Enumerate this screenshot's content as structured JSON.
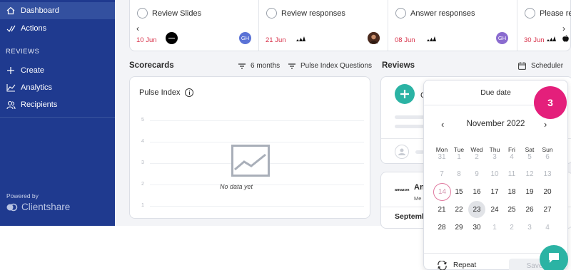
{
  "sidebar": {
    "items": [
      {
        "label": "Dashboard",
        "icon": "home-icon",
        "active": true
      },
      {
        "label": "Actions",
        "icon": "actions-check-icon"
      }
    ],
    "section_title": "REVIEWS",
    "review_items": [
      {
        "label": "Create",
        "icon": "plus-icon"
      },
      {
        "label": "Analytics",
        "icon": "analytics-chart-icon"
      },
      {
        "label": "Recipients",
        "icon": "recipients-icon"
      }
    ],
    "powered_by": "Powered by",
    "brand": "Clientshare",
    "colors": {
      "background": "#1f3a8f",
      "active": "#33509f"
    }
  },
  "tasks": [
    {
      "title": "Review Slides",
      "date": "10 Jun",
      "org_logo": "black-circle-logo",
      "avatar": "GH",
      "avatar_color": "#5a72d6"
    },
    {
      "title": "Review responses",
      "date": "21 Jun",
      "org_logo": "adidas-logo",
      "avatar": "photo-avatar"
    },
    {
      "title": "Answer responses",
      "date": "08 Jun",
      "org_logo": "adidas-logo",
      "avatar": "GH",
      "avatar_color": "#8a6bcf"
    },
    {
      "title": "Please rev",
      "date": "30 Jun",
      "org_logo": "adidas-logo",
      "avatar": "apple-logo"
    }
  ],
  "scorecards": {
    "title": "Scorecards",
    "filter_period": "6 months",
    "filter_questions": "Pulse Index Questions"
  },
  "pulse": {
    "title": "Pulse Index",
    "info": "i",
    "y_ticks": [
      "5",
      "4",
      "3",
      "2",
      "1"
    ],
    "empty_text": "No data yet"
  },
  "reviews": {
    "title": "Reviews",
    "scheduler_label": "Scheduler",
    "card_letter": "C",
    "preview_title": "An",
    "preview_sub": "Me",
    "preview_brand": "amazon",
    "preview_month": "Septemb"
  },
  "datepicker": {
    "title": "Due date",
    "month": "November 2022",
    "weekdays": [
      "Mon",
      "Tue",
      "Wed",
      "Thu",
      "Fri",
      "Sat",
      "Sun"
    ],
    "weeks": [
      [
        "31",
        "1",
        "2",
        "3",
        "4",
        "5",
        "6"
      ],
      [
        "7",
        "8",
        "9",
        "10",
        "11",
        "12",
        "13"
      ],
      [
        "14",
        "15",
        "16",
        "17",
        "18",
        "19",
        "20"
      ],
      [
        "21",
        "22",
        "23",
        "24",
        "25",
        "26",
        "27"
      ],
      [
        "28",
        "29",
        "30",
        "1",
        "2",
        "3",
        "4"
      ]
    ],
    "disabled_before": "15",
    "today": "14",
    "selected": "23",
    "repeat_label": "Repeat",
    "save_label": "Save"
  },
  "step_badge": "3",
  "accent_colors": {
    "teal": "#2bb3a4",
    "badge": "#e41f7b",
    "date_red": "#d8324a"
  }
}
